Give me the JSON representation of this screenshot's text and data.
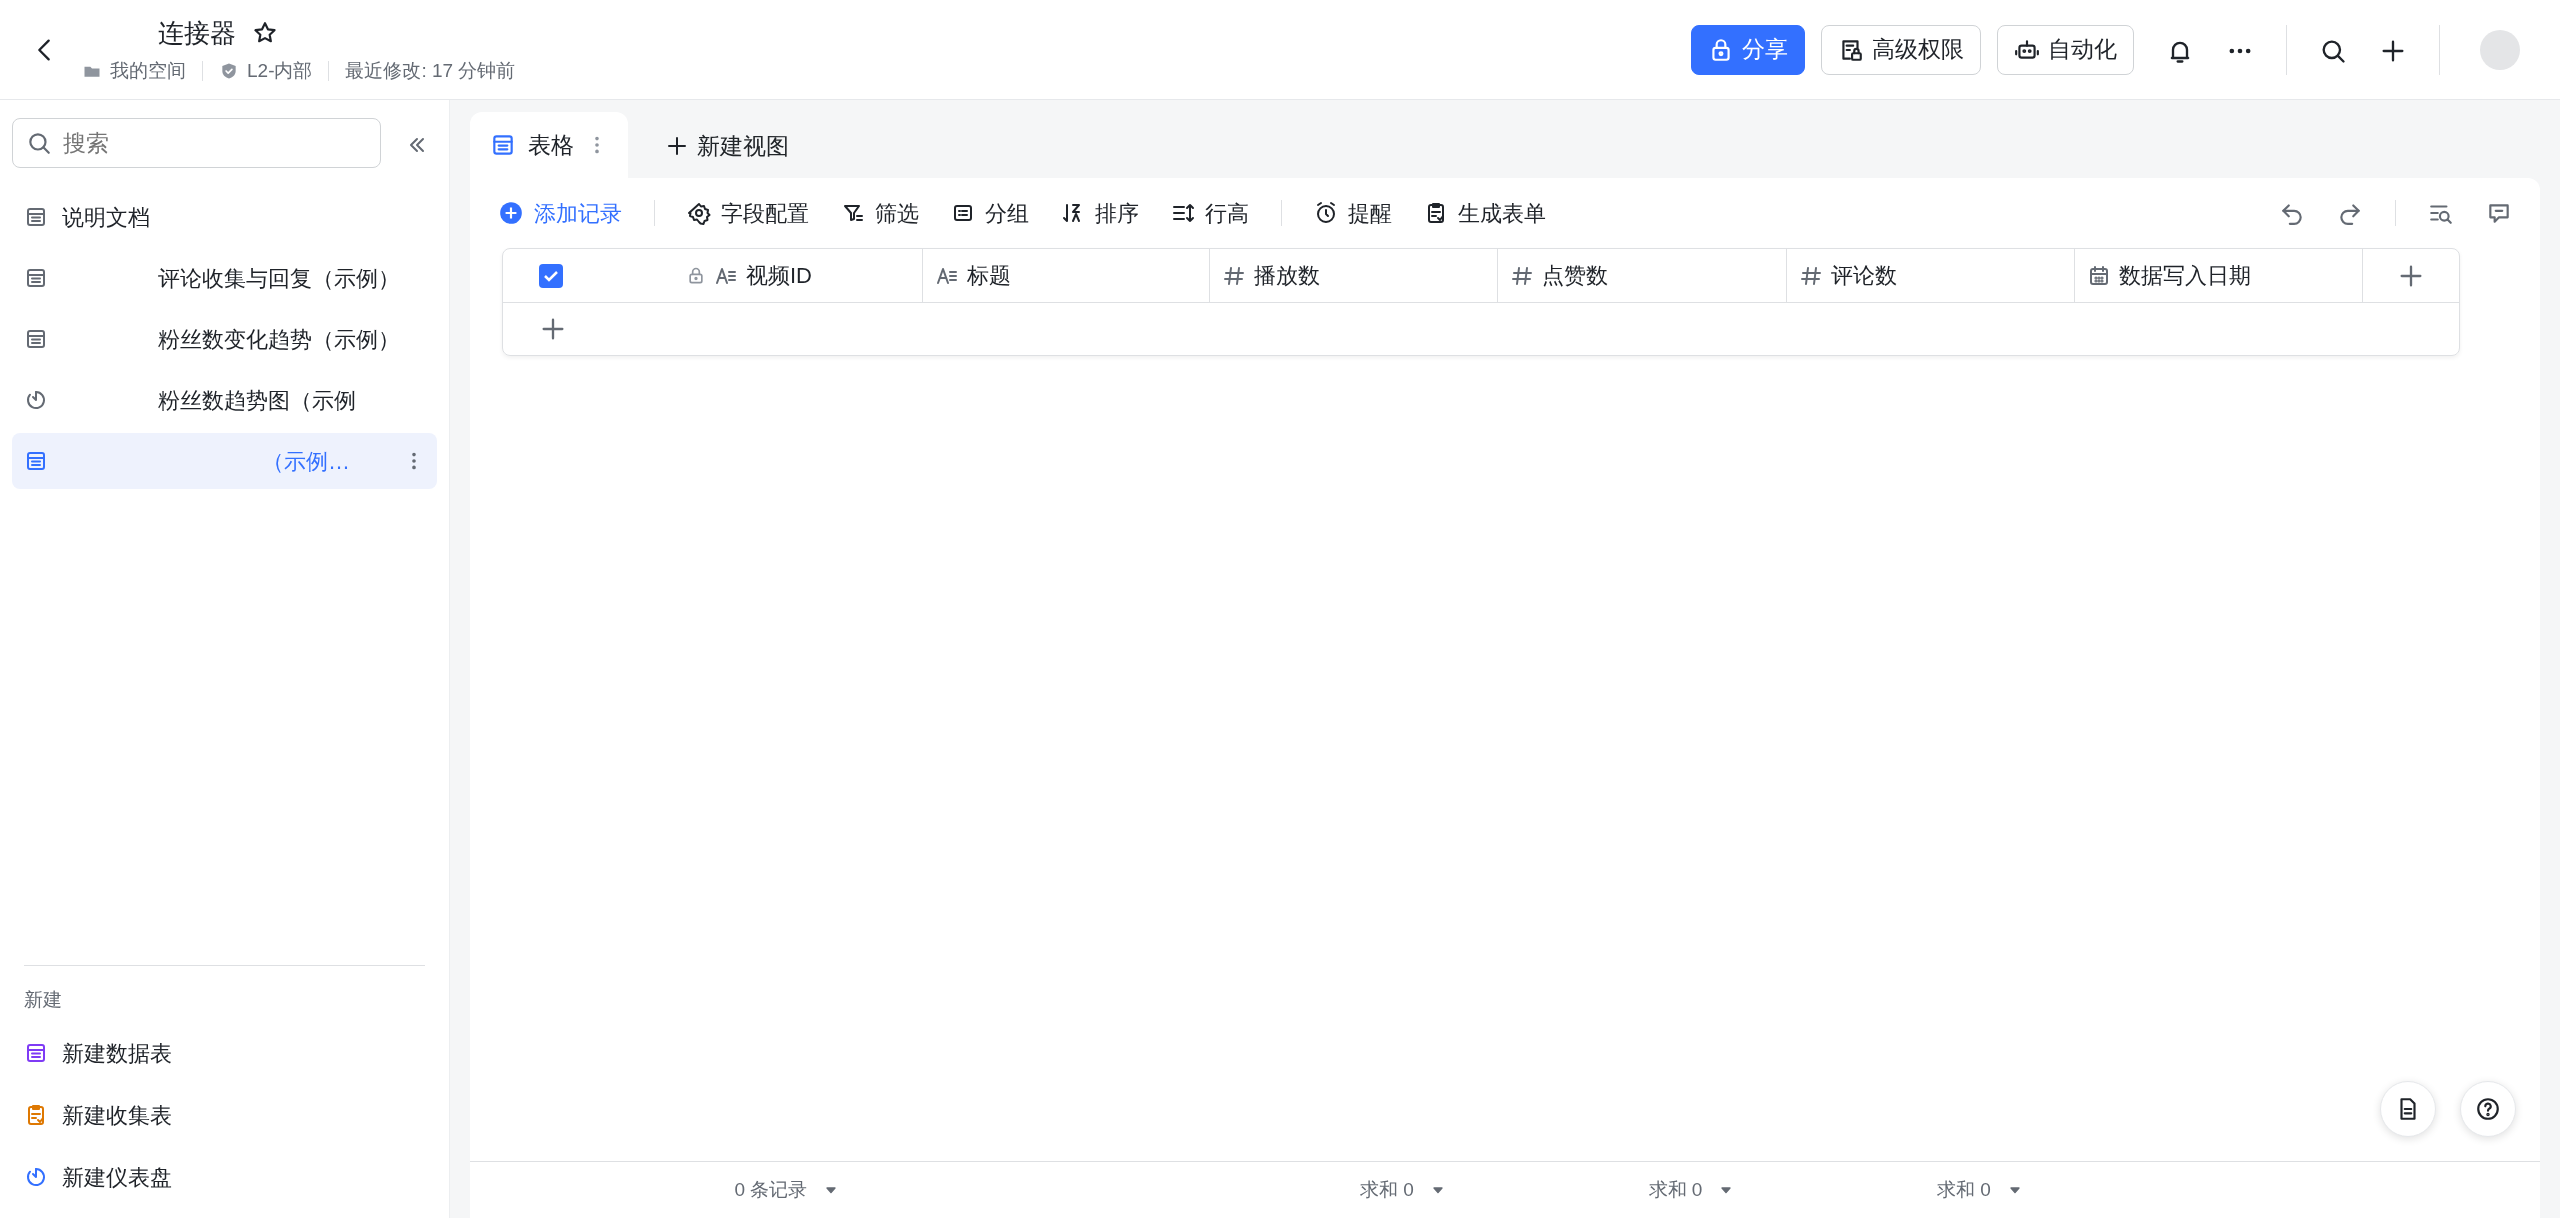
{
  "header": {
    "title": "连接器",
    "starred": false,
    "meta": [
      "我的空间",
      "L2-内部",
      "最近修改: 17 分钟前"
    ]
  },
  "actions": [
    {
      "kind": "share",
      "label": "分享"
    },
    {
      "kind": "permission",
      "label": "高级权限"
    },
    {
      "kind": "automation",
      "label": "自动化"
    }
  ],
  "sidebar": {
    "search": {
      "placeholder": "搜索"
    },
    "items": [
      {
        "kind": "table",
        "label": "说明文档",
        "selected": false
      },
      {
        "kind": "table",
        "label": "评论收集与回复（示例）",
        "selected": false
      },
      {
        "kind": "table",
        "label": "粉丝数变化趋势（示例）",
        "selected": false
      },
      {
        "kind": "dashboard",
        "label": "粉丝数趋势图（示例",
        "selected": false
      },
      {
        "kind": "table",
        "label": "（示例…",
        "selected": true
      }
    ],
    "new_section": {
      "title": "新建",
      "items": [
        {
          "kind": "table",
          "label": "新建数据表"
        },
        {
          "kind": "form",
          "label": "新建收集表"
        },
        {
          "kind": "dashboard",
          "label": "新建仪表盘"
        }
      ]
    }
  },
  "views": {
    "tabs": [
      {
        "label": "表格",
        "selected": true
      }
    ],
    "new_view": "新建视图"
  },
  "toolbar": {
    "add_record": "添加记录",
    "tools": [
      {
        "kind": "fields",
        "label": "字段配置"
      },
      {
        "kind": "filter",
        "label": "筛选"
      },
      {
        "kind": "group",
        "label": "分组"
      },
      {
        "kind": "sort",
        "label": "排序"
      },
      {
        "kind": "height",
        "label": "行高"
      },
      {
        "kind": "reminder",
        "label": "提醒"
      },
      {
        "kind": "form",
        "label": "生成表单"
      }
    ]
  },
  "table": {
    "select_all": {
      "checked": true
    },
    "columns": [
      {
        "kind": "text",
        "label": "视频ID",
        "locked": true,
        "summary": "0 条记录"
      },
      {
        "kind": "text",
        "label": "标题",
        "locked": false
      },
      {
        "kind": "number",
        "label": "播放数",
        "locked": false,
        "summary": "求和 0"
      },
      {
        "kind": "number",
        "label": "点赞数",
        "locked": false,
        "summary": "求和 0"
      },
      {
        "kind": "number",
        "label": "评论数",
        "locked": false,
        "summary": "求和 0"
      },
      {
        "kind": "date",
        "label": "数据写入日期",
        "locked": false
      }
    ]
  }
}
